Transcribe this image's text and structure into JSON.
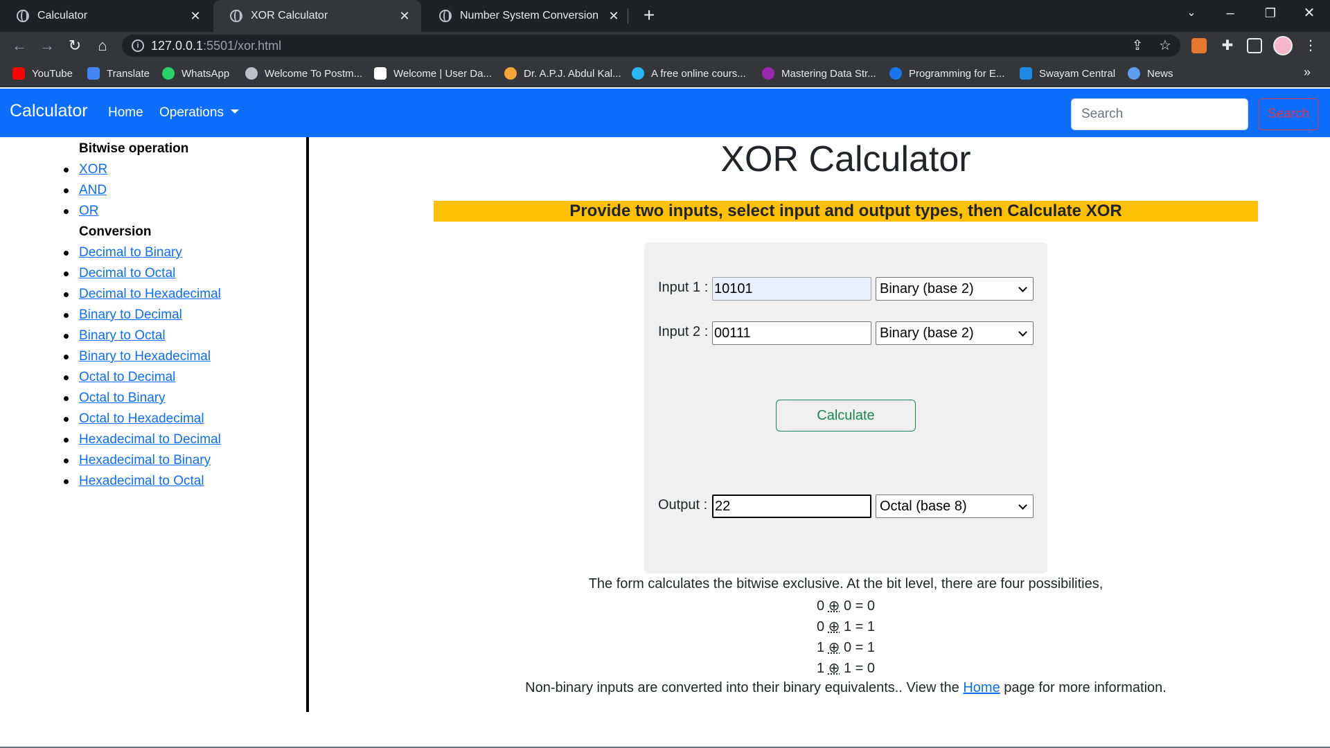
{
  "browser": {
    "tabs": [
      {
        "title": "Calculator"
      },
      {
        "title": "XOR Calculator"
      },
      {
        "title": "Number System Conversion"
      }
    ],
    "address": {
      "host": "127.0.0.1",
      "path": ":5501/xor.html"
    },
    "bookmarks": [
      {
        "label": "YouTube",
        "color": "#ff0000"
      },
      {
        "label": "Translate",
        "color": "#4285f4"
      },
      {
        "label": "WhatsApp",
        "color": "#25d366"
      },
      {
        "label": "Welcome To Postm...",
        "color": "#bdc1c6"
      },
      {
        "label": "Welcome | User Da...",
        "color": "#ffffff"
      },
      {
        "label": "Dr. A.P.J. Abdul Kal...",
        "color": "#f2a33a"
      },
      {
        "label": "A free online cours...",
        "color": "#29b6f6"
      },
      {
        "label": "Mastering Data Str...",
        "color": "#9c27b0"
      },
      {
        "label": "Programming for E...",
        "color": "#1a73e8"
      },
      {
        "label": "Swayam Central",
        "color": "#1e88e5"
      },
      {
        "label": "News",
        "color": "#5c9ded"
      }
    ],
    "bookmarks_more": "»"
  },
  "navbar": {
    "brand": "Calculator",
    "home": "Home",
    "operations": "Operations",
    "search_placeholder": "Search",
    "search_button": "Search",
    "color": "#0d6efd"
  },
  "sidebar": {
    "bitwise_heading": "Bitwise operation",
    "bitwise_items": [
      "XOR",
      "AND",
      "OR"
    ],
    "conversion_heading": "Conversion",
    "conversion_items": [
      "Decimal to Binary",
      "Decimal to Octal",
      "Decimal to Hexadecimal",
      "Binary to Decimal",
      "Binary to Octal",
      "Binary to Hexadecimal",
      "Octal to Decimal",
      "Octal to Binary",
      "Octal to Hexadecimal",
      "Hexadecimal to Decimal",
      "Hexadecimal to Binary",
      "Hexadecimal to Octal"
    ]
  },
  "main": {
    "title": "XOR Calculator",
    "banner": "Provide two inputs, select input and output types, then Calculate XOR",
    "banner_color": "#ffc107",
    "input1": {
      "label": "Input 1 :",
      "value": "10101",
      "type": "Binary (base 2)"
    },
    "input2": {
      "label": "Input 2 :",
      "value": "00111",
      "type": "Binary (base 2)"
    },
    "calculate_button": "Calculate",
    "output": {
      "label": "Output :",
      "value": "22",
      "type": "Octal (base 8)"
    },
    "description": "The form calculates the bitwise exclusive. At the bit level, there are four possibilities,",
    "truth_table": [
      {
        "a": "0",
        "op": "⊕",
        "b": "0",
        "eq": "=",
        "r": "0"
      },
      {
        "a": "0",
        "op": "⊕",
        "b": "1",
        "eq": "=",
        "r": "1"
      },
      {
        "a": "1",
        "op": "⊕",
        "b": "0",
        "eq": "=",
        "r": "1"
      },
      {
        "a": "1",
        "op": "⊕",
        "b": "1",
        "eq": "=",
        "r": "0"
      }
    ],
    "footer_before": "Non-binary inputs are converted into their binary equivalents.. View the ",
    "footer_link": "Home",
    "footer_after": " page for more information."
  }
}
